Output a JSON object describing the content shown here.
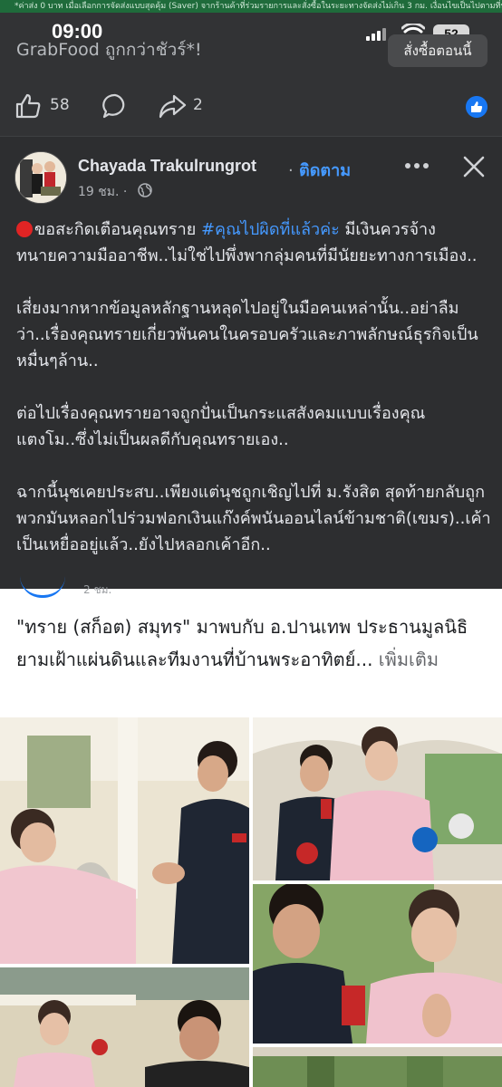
{
  "status_bar": {
    "time": "09:00",
    "battery": "52"
  },
  "promo_strip": {
    "text": "*ค่าส่ง 0 บาท เมื่อเลือกการจัดส่งแบบสุดคุ้ม (Saver) จากร้านค้าที่ร่วมรายการและสั่งซื้อในระยะทางจัดส่งไม่เกิน 3 กม. เงื่อนไขเป็นไปตามที่บริษัทกำหนด"
  },
  "ad": {
    "title": "GrabFood ถูกกว่าชัวร์*!",
    "order_label": "สั่งซื้อตอนนี้"
  },
  "reactions": {
    "likes": "58",
    "shares": "2"
  },
  "post": {
    "author": "Chayada Trakulrungrot",
    "separator": "·",
    "follow_label": "ติดตาม",
    "time": "19 ชม. ·",
    "paragraphs": [
      {
        "prefix": "ขอสะกิดเตือนคุณทราย ",
        "hashtag": "#คุณไปผิดที่แล้วค่ะ",
        "suffix": " มีเงินควรจ้างทนายความมืออาชีพ..ไม่ใช่ไปพึ่งพากลุ่มคนที่มีนัยยะทางการเมือง.."
      },
      {
        "text": "เสี่ยงมากหากข้อมูลหลักฐานหลุดไปอยู่ในมือคนเหล่านั้น..อย่าลืมว่า..เรื่องคุณทรายเกี่ยวพันคนในครอบครัวและภาพลักษณ์ธุรกิจเป็นหมื่นๆล้าน.."
      },
      {
        "text": "ต่อไปเรื่องคุณทรายอาจถูกปั่นเป็นกระแสสังคมแบบเรื่องคุณแตงโม..ซึ่งไม่เป็นผลดีกับคุณทรายเอง.."
      },
      {
        "text": "ฉากนี้นุชเคยประสบ..เพียงแต่นุชถูกเชิญไปที่ ม.รังสิต สุดท้ายกลับถูกพวกมันหลอกไปร่วมฟอกเงินแก๊งค์พนันออนไลน์ข้ามชาติ(เขมร)..เค้าเป็นเหยื่ออยู่แล้ว..ยังไปหลอกเค้าอีก.."
      }
    ]
  },
  "feed": {
    "peek_time": "2 ชม.",
    "caption": "\"ทราย (สก็อต) สมุทร\" มาพบกับ อ.ปานเทพ ประธานมูลนิธิยามเฝ้าแผ่นดินและทีมงานที่บ้านพระอาทิตย์...",
    "see_more": "เพิ่มเติม"
  },
  "colors": {
    "accent": "#4599ff",
    "fb_blue": "#1877f2",
    "dark_bg": "#2d2e30"
  }
}
